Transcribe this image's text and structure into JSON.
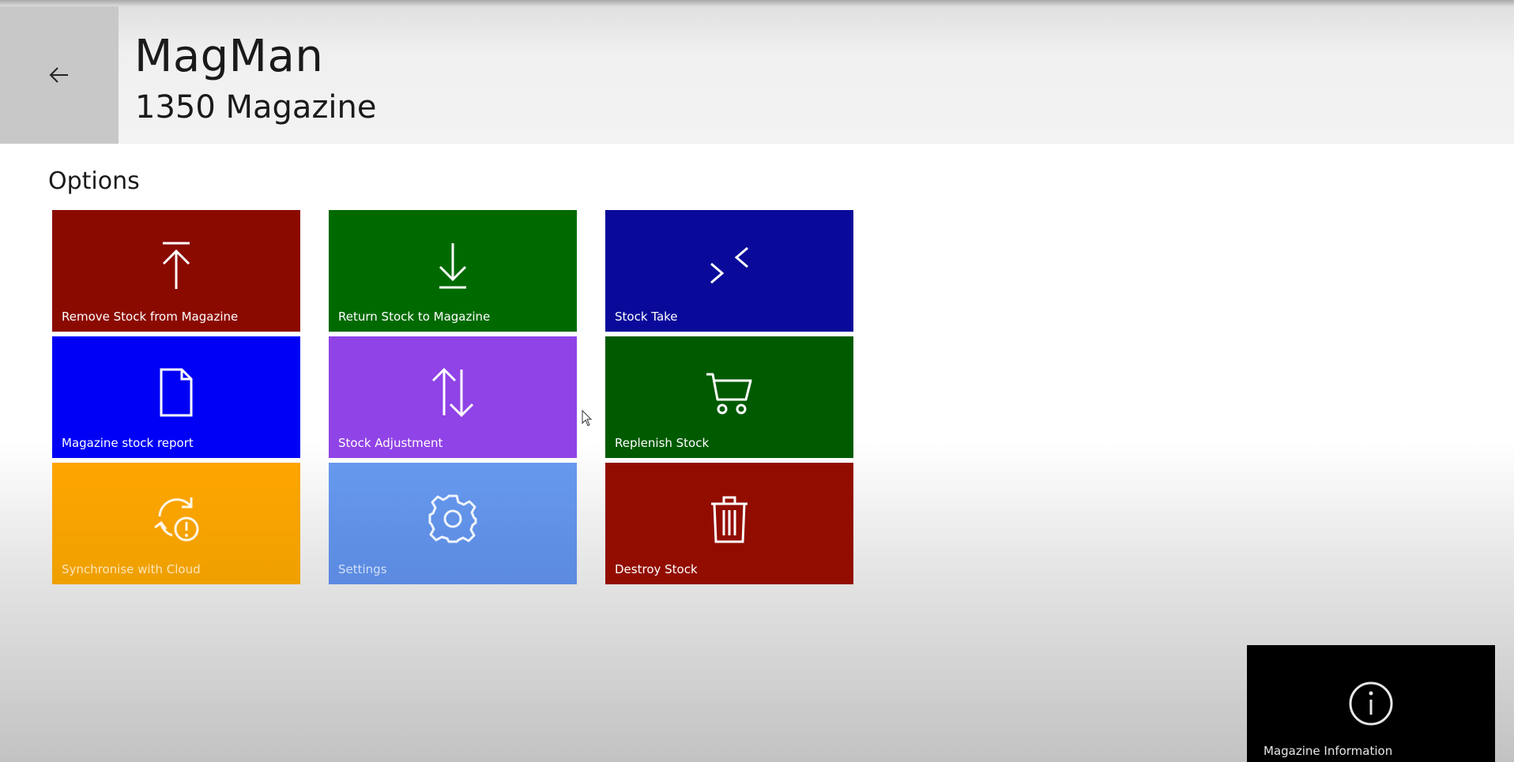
{
  "header": {
    "back_icon": "back-arrow-icon",
    "app_title": "MagMan",
    "subtitle": "1350 Magazine"
  },
  "section": {
    "title": "Options"
  },
  "tiles": [
    {
      "label": "Remove Stock from Magazine",
      "icon": "arrow-up-to-bar-icon",
      "color": "#8b0a00"
    },
    {
      "label": "Return Stock to Magazine",
      "icon": "arrow-down-to-bar-icon",
      "color": "#006a00"
    },
    {
      "label": "Stock Take",
      "icon": "collapse-chevrons-icon",
      "color": "#0a0a9a"
    },
    {
      "label": "Magazine stock report",
      "icon": "document-icon",
      "color": "#0000f5"
    },
    {
      "label": "Stock Adjustment",
      "icon": "up-down-arrows-icon",
      "color": "#9043e6"
    },
    {
      "label": "Replenish Stock",
      "icon": "shopping-cart-icon",
      "color": "#005a00"
    },
    {
      "label": "Synchronise with Cloud",
      "icon": "sync-alert-icon",
      "color": "#ffa500"
    },
    {
      "label": "Settings",
      "icon": "gear-icon",
      "color": "#6699ee"
    },
    {
      "label": "Destroy Stock",
      "icon": "trash-icon",
      "color": "#920d00"
    }
  ],
  "info_tile": {
    "label": "Magazine Information",
    "icon": "info-circle-icon",
    "color": "#000000"
  }
}
